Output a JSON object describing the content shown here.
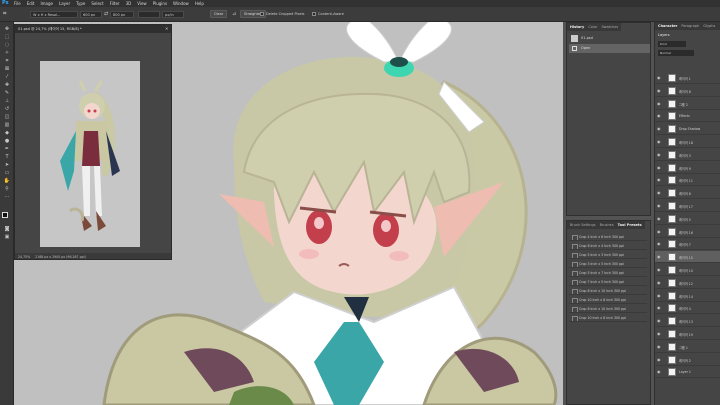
{
  "app": {
    "logo": "Ps",
    "accent": "#31a8ff"
  },
  "menu": [
    "File",
    "Edit",
    "Image",
    "Layer",
    "Type",
    "Select",
    "Filter",
    "3D",
    "View",
    "Plugins",
    "Window",
    "Help"
  ],
  "options": {
    "ratio": "W x H x Resol...",
    "width": "600 px",
    "height": "800 px",
    "resolution": "",
    "unit": "px/in",
    "clear": "Clear",
    "straighten": "Straighten",
    "delete_cropped": "Delete Cropped Pixels",
    "content_aware": "Content-Aware"
  },
  "document": {
    "tab_title": "01.psd @ 24,7% (레이어 15, RGB/8) *",
    "zoom": "24,75%",
    "status": "2168 px x 2900 px (96.267 ppi)"
  },
  "history": {
    "tabs": [
      "History",
      "Color",
      "Swatches"
    ],
    "active_tab": "History",
    "items": [
      "01.psd",
      "Open"
    ]
  },
  "presets": {
    "tabs": [
      "Brush Settings",
      "Brushes",
      "Tool Presets"
    ],
    "active_tab": "Tool Presets",
    "items": [
      "Crop 4 Inch x 6 Inch 300 ppi",
      "Crop 6 Inch x 4 Inch 300 ppi",
      "Crop 5 Inch x 3 Inch 300 ppi",
      "Crop 3 Inch x 5 Inch 300 ppi",
      "Crop 5 Inch x 7 Inch 300 ppi",
      "Crop 7 Inch x 5 Inch 300 ppi",
      "Crop 8 Inch x 10 Inch 300 ppi",
      "Crop 10 Inch x 8 Inch 300 ppi",
      "Crop 8 Inch x 10 Inch 300 ppi",
      "Crop 10 Inch x 8 Inch 300 ppi"
    ]
  },
  "layers": {
    "tabs": [
      "Character",
      "Paragraph",
      "Glyphs"
    ],
    "panel_title": "Layers",
    "filter": "Kind",
    "blend": "Normal",
    "items": [
      {
        "name": "레이어 1"
      },
      {
        "name": "레이어 8"
      },
      {
        "name": "그룹 2"
      },
      {
        "name": "Effects"
      },
      {
        "name": "Drop Shadow"
      },
      {
        "name": "레이어 18"
      },
      {
        "name": "레이어 3"
      },
      {
        "name": "레이어 9"
      },
      {
        "name": "레이어 11"
      },
      {
        "name": "레이어 6"
      },
      {
        "name": "레이어 17"
      },
      {
        "name": "레이어 5"
      },
      {
        "name": "레이어 16"
      },
      {
        "name": "레이어 7"
      },
      {
        "name": "레이어 15"
      },
      {
        "name": "레이어 10"
      },
      {
        "name": "레이어 12"
      },
      {
        "name": "레이어 14"
      },
      {
        "name": "레이어 4"
      },
      {
        "name": "레이어 13"
      },
      {
        "name": "레이어 19"
      },
      {
        "name": "그룹 1"
      },
      {
        "name": "레이어 2"
      },
      {
        "name": "Layer 1"
      }
    ]
  },
  "colors": {
    "art_bg": "#bfbfbf",
    "hair": "#c8c8a8",
    "skin": "#f2d4cc",
    "eyes": "#c9424f",
    "tie": "#3aa6a8",
    "bow": "#3dd6b0"
  }
}
